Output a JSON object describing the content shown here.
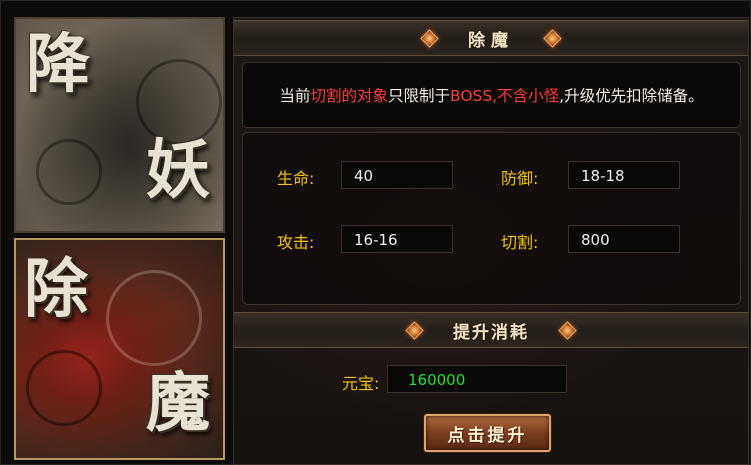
{
  "tabs": {
    "top": {
      "char1": "降",
      "char2": "妖"
    },
    "bottom": {
      "char1": "除",
      "char2": "魔"
    }
  },
  "panel": {
    "title": "除魔",
    "notice": {
      "part1": "当前",
      "part2": "切割的对象",
      "part3": "只限制于",
      "part4": "BOSS,不含小怪",
      "part5": ",升级优先扣除储备。"
    },
    "stats": {
      "hp_label": "生命:",
      "hp_value": "40",
      "def_label": "防御:",
      "def_value": "18-18",
      "atk_label": "攻击:",
      "atk_value": "16-16",
      "cut_label": "切割:",
      "cut_value": "800"
    },
    "cost": {
      "title": "提升消耗",
      "ingot_label": "元宝:",
      "ingot_value": "160000"
    },
    "upgrade_button": "点击提升"
  },
  "colors": {
    "label_yellow": "#f5c400",
    "highlight_red": "#ff3b3b",
    "cost_green": "#22e022"
  }
}
